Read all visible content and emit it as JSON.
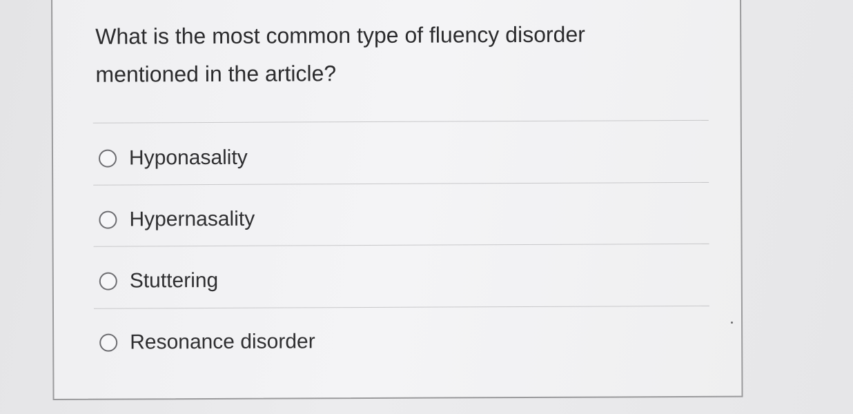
{
  "question": {
    "text": "What is the most common type of fluency disorder mentioned in the article?"
  },
  "options": [
    {
      "label": "Hyponasality",
      "selected": false
    },
    {
      "label": "Hypernasality",
      "selected": false
    },
    {
      "label": "Stuttering",
      "selected": false
    },
    {
      "label": "Resonance disorder",
      "selected": false
    }
  ],
  "colors": {
    "background": "#e8e8ea",
    "card": "#f2f2f4",
    "border": "#9a9a9c",
    "text": "#2b2b2d",
    "radio_border": "#6c6c70"
  }
}
